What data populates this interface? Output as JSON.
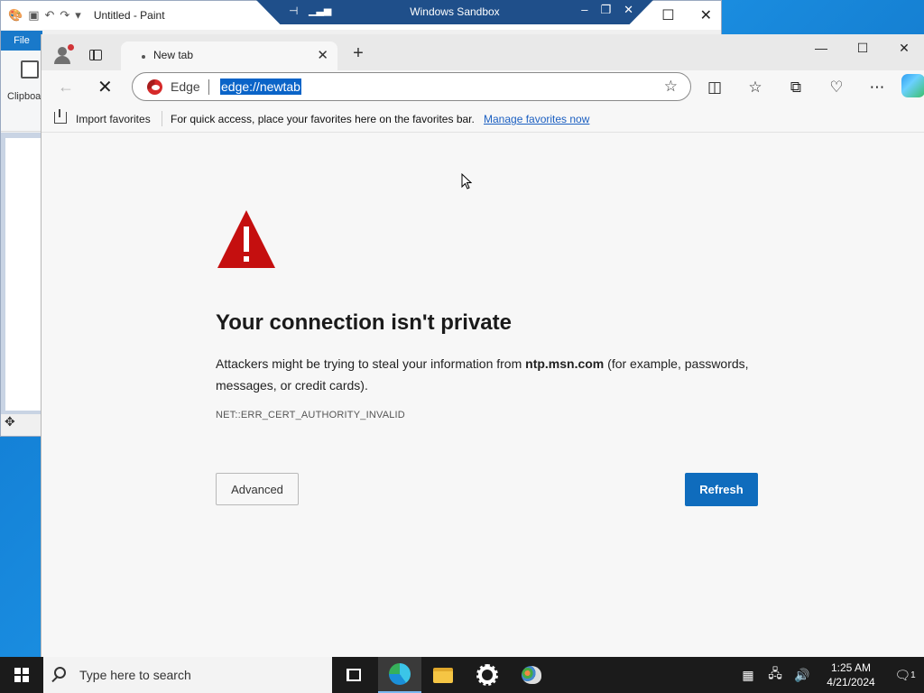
{
  "paint": {
    "title": "Untitled - Paint",
    "file_tab": "File",
    "clipboard_label": "Clipboa"
  },
  "sandbox": {
    "title": "Windows Sandbox"
  },
  "edge": {
    "tab_title": "New tab",
    "address_label": "Edge",
    "url": "edge://newtab",
    "favorites_bar": {
      "import_label": "Import favorites",
      "message": "For quick access, place your favorites here on the favorites bar.",
      "manage_link": "Manage favorites now"
    },
    "error": {
      "heading": "Your connection isn't private",
      "desc_before": "Attackers might be trying to steal your information from",
      "host": "ntp.msn.com",
      "desc_after": "(for example, passwords, messages, or credit cards).",
      "code": "NET::ERR_CERT_AUTHORITY_INVALID",
      "advanced_label": "Advanced",
      "refresh_label": "Refresh"
    },
    "colors": {
      "accent": "#0f6cbd",
      "warning": "#c50f0f"
    }
  },
  "taskbar": {
    "search_placeholder": "Type here to search",
    "time": "1:25 AM",
    "date": "4/21/2024",
    "notification_count": "1"
  }
}
